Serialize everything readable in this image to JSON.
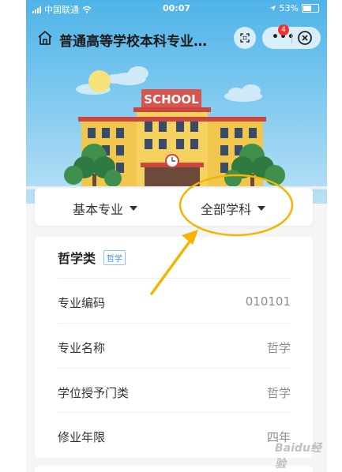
{
  "status_bar": {
    "carrier": "中国联通",
    "time": "00:07",
    "battery_percent": "53%"
  },
  "nav": {
    "title": "普通高等学校本科专业…",
    "badge_count": "4"
  },
  "hero": {
    "sign_text": "SCHOOL"
  },
  "tabs": [
    {
      "label": "基本专业"
    },
    {
      "label": "全部学科"
    }
  ],
  "category": {
    "title": "哲学类",
    "tag": "哲学"
  },
  "rows": [
    {
      "label": "专业编码",
      "value": "010101"
    },
    {
      "label": "专业名称",
      "value": "哲学"
    },
    {
      "label": "学位授予门类",
      "value": "哲学"
    },
    {
      "label": "修业年限",
      "value": "四年"
    }
  ],
  "watermark": "Baidu经验",
  "colors": {
    "sky": "#4fb3e8",
    "annotation": "#f4b400",
    "tag_blue": "#3d8fe0"
  }
}
